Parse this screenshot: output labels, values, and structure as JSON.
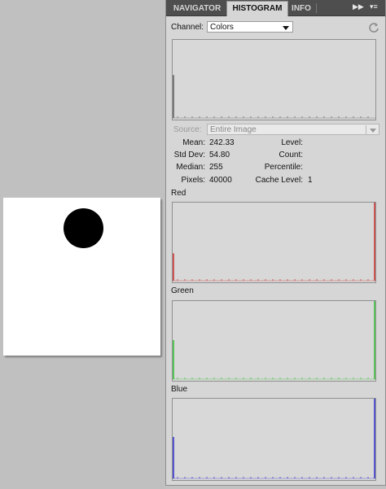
{
  "tabs": [
    {
      "label": "NAVIGATOR",
      "active": false
    },
    {
      "label": "HISTOGRAM",
      "active": true
    },
    {
      "label": "INFO",
      "active": false
    }
  ],
  "channel": {
    "label": "Channel:",
    "value": "Colors"
  },
  "source": {
    "label": "Source:",
    "value": "Entire Image"
  },
  "stats": {
    "mean_label": "Mean:",
    "mean": "242.33",
    "stddev_label": "Std Dev:",
    "stddev": "54.80",
    "median_label": "Median:",
    "median": "255",
    "pixels_label": "Pixels:",
    "pixels": "40000",
    "level_label": "Level:",
    "level": "",
    "count_label": "Count:",
    "count": "",
    "percentile_label": "Percentile:",
    "percentile": "",
    "cache_label": "Cache Level:",
    "cache": "1"
  },
  "histograms": [
    {
      "name": "Colors",
      "label": "",
      "color": "#5a5a5a",
      "low_bar": 0.55,
      "high_bar": 0
    },
    {
      "name": "Red",
      "label": "Red",
      "color": "#cc2a2a",
      "low_bar": 0.35,
      "high_bar": 1
    },
    {
      "name": "Green",
      "label": "Green",
      "color": "#2fbf2f",
      "low_bar": 0.5,
      "high_bar": 1
    },
    {
      "name": "Blue",
      "label": "Blue",
      "color": "#2b2bd0",
      "low_bar": 0.52,
      "high_bar": 1
    }
  ],
  "document": {
    "shape": "black circle on white canvas"
  },
  "colors": {
    "panel_bg": "#d6d6d6",
    "tabbar_bg": "#4e4e4e",
    "canvas_bg": "#c0c0c0"
  }
}
